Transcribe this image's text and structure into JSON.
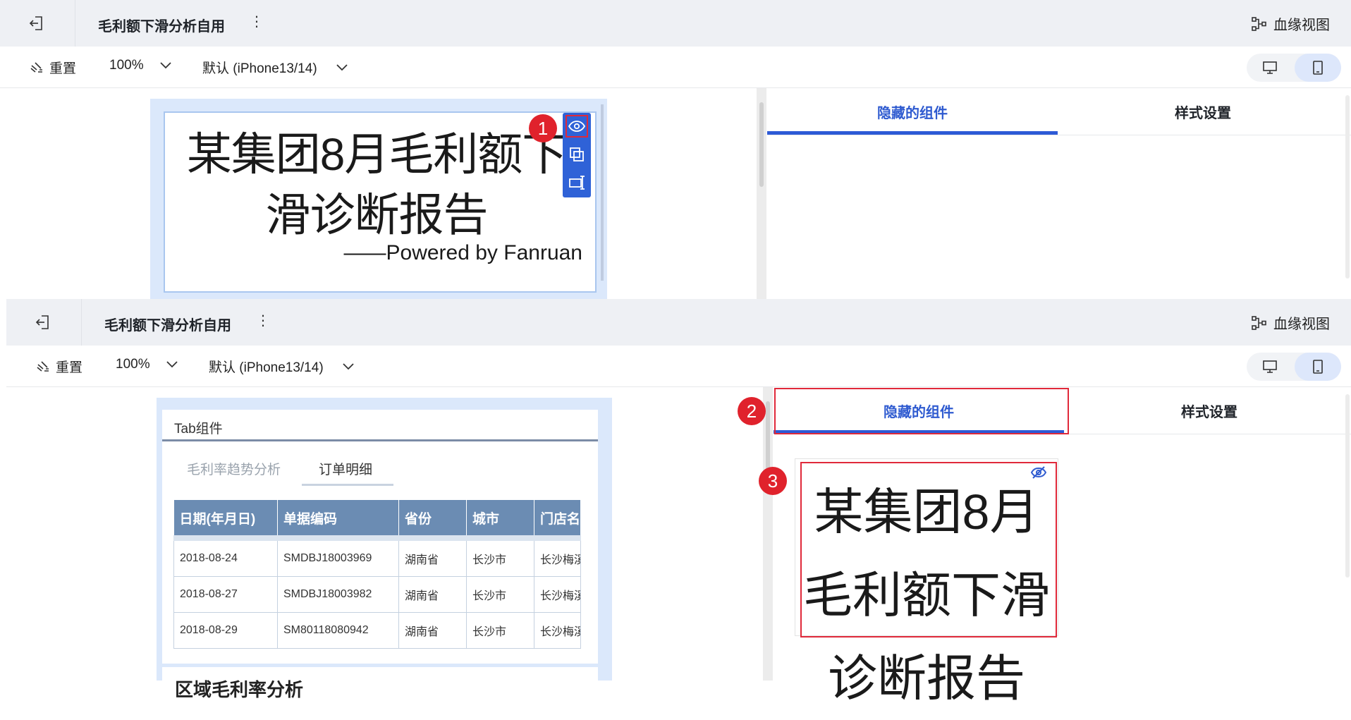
{
  "header": {
    "exit_icon": "exit-icon",
    "title": "毛利额下滑分析自用",
    "more_icon": "more-vertical-icon",
    "more_glyph": "⋮",
    "lineage_icon": "lineage-icon",
    "lineage_label": "血缘视图"
  },
  "toolbar": {
    "reset_icon": "broom-icon",
    "reset_label": "重置",
    "zoom": "100%",
    "device": "默认 (iPhone13/14)",
    "desktop_icon": "desktop-icon",
    "mobile_icon": "mobile-icon"
  },
  "panel": {
    "tab_hidden": "隐藏的组件",
    "tab_style": "样式设置"
  },
  "title_component": {
    "text": "某集团8月毛利额下滑诊断报告",
    "subtitle": "——Powered by Fanruan",
    "actions": [
      "eye-icon",
      "copy-icon",
      "move-icon"
    ]
  },
  "tab_component": {
    "title": "Tab组件",
    "tabs": [
      "毛利率趋势分析",
      "订单明细"
    ],
    "table": {
      "headers": [
        "日期(年月日)",
        "单据编码",
        "省份",
        "城市",
        "门店名"
      ],
      "rows": [
        [
          "2018-08-24",
          "SMDBJ18003969",
          "湖南省",
          "长沙市",
          "长沙梅溪湖"
        ],
        [
          "2018-08-27",
          "SMDBJ18003982",
          "湖南省",
          "长沙市",
          "长沙梅溪湖"
        ],
        [
          "2018-08-29",
          "SM80118080942",
          "湖南省",
          "长沙市",
          "长沙梅溪湖"
        ]
      ]
    },
    "next_component_title": "区域毛利率分析"
  },
  "hidden_component": {
    "text": "某集团8月毛利额下滑诊断报告",
    "icon": "eye-off-icon"
  },
  "badges": [
    "1",
    "2",
    "3"
  ],
  "colors": {
    "accent": "#2f5bd0",
    "highlight": "#e0293a",
    "table_header": "#6b8cb3"
  }
}
